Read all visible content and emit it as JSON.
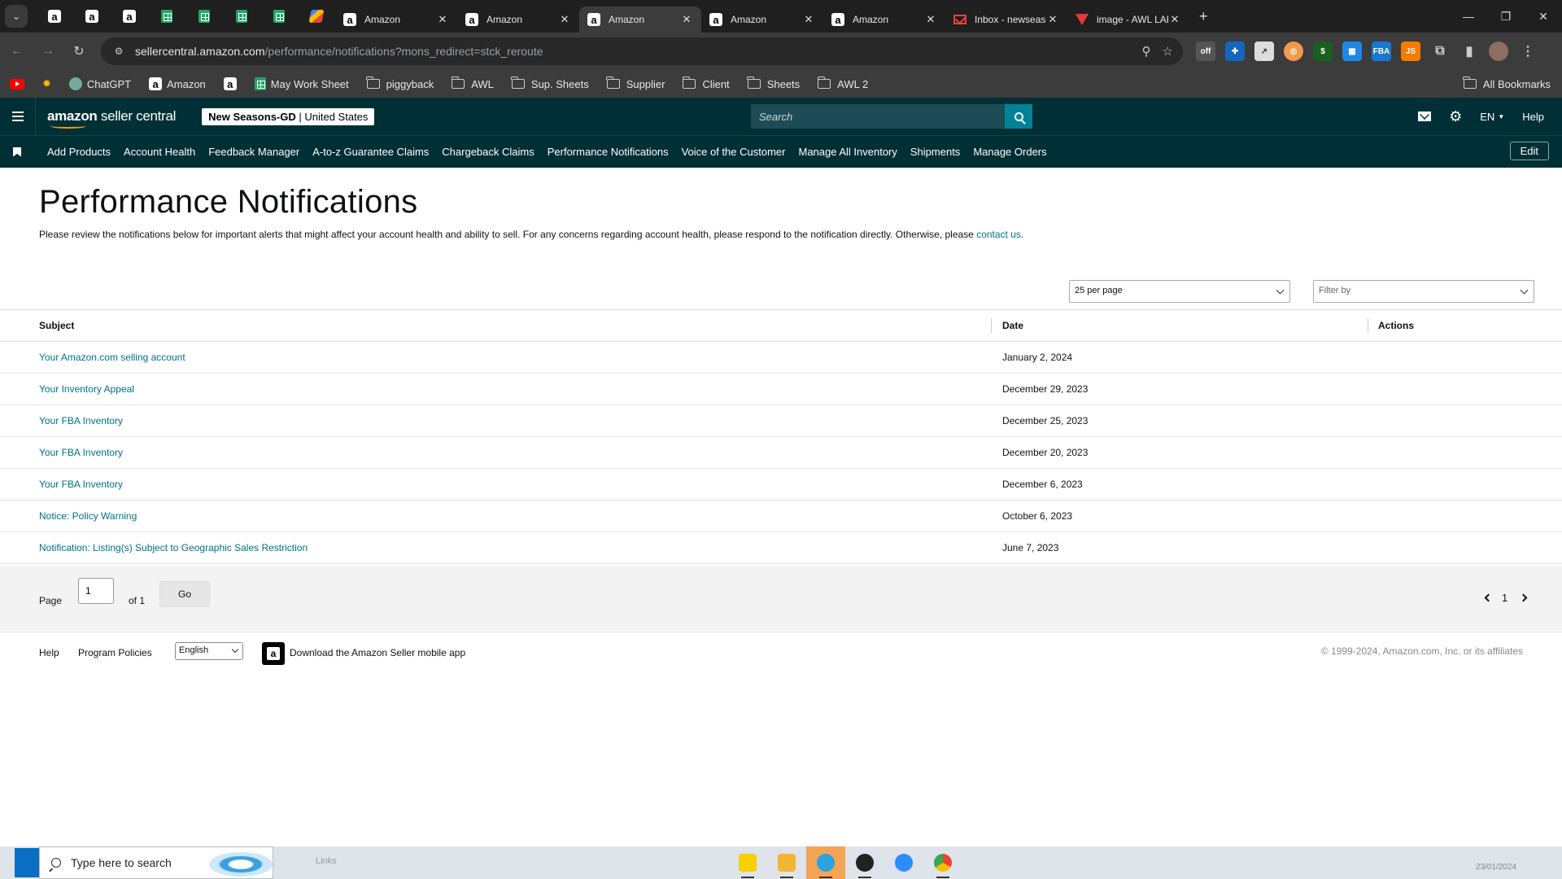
{
  "browser": {
    "tabs": [
      {
        "label": "Amazon",
        "active": false
      },
      {
        "label": "Amazon",
        "active": false
      },
      {
        "label": "Amazon",
        "active": true
      },
      {
        "label": "Amazon",
        "active": false
      },
      {
        "label": "Amazon",
        "active": false
      },
      {
        "label": "Inbox - newseasonsg",
        "active": false
      },
      {
        "label": "image - AWL LABEL",
        "active": false
      }
    ],
    "url_host": "sellercentral.amazon.com",
    "url_path": "/performance/notifications?mons_redirect=stck_reroute",
    "bookmarks": [
      "ChatGPT",
      "Amazon",
      "May Work Sheet",
      "piggyback",
      "AWL",
      "Sup. Sheets",
      "Supplier",
      "Client",
      "Sheets",
      "AWL 2"
    ],
    "all_bookmarks": "All Bookmarks"
  },
  "header": {
    "logo_bold": "amazon",
    "logo_rest": " seller central",
    "account_bold": "New Seasons-GD",
    "account_rest": " | United States",
    "search_placeholder": "Search",
    "language": "EN",
    "help": "Help"
  },
  "nav": {
    "items": [
      "Add Products",
      "Account Health",
      "Feedback Manager",
      "A-to-z Guarantee Claims",
      "Chargeback Claims",
      "Performance Notifications",
      "Voice of the Customer",
      "Manage All Inventory",
      "Shipments",
      "Manage Orders"
    ],
    "edit": "Edit"
  },
  "main": {
    "title": "Performance Notifications",
    "intro": "Please review the notifications below for important alerts that might affect your account health and ability to sell. For any concerns regarding account health, please respond to the notification directly. Otherwise, please ",
    "contact_link": "contact us",
    "intro_end": ".",
    "per_page": "25 per page",
    "filter_placeholder": "Filter by",
    "columns": {
      "subject": "Subject",
      "date": "Date",
      "actions": "Actions"
    },
    "rows": [
      {
        "subject": "Your Amazon.com selling account",
        "date": "January 2, 2024"
      },
      {
        "subject": "Your Inventory Appeal",
        "date": "December 29, 2023"
      },
      {
        "subject": "Your FBA Inventory",
        "date": "December 25, 2023"
      },
      {
        "subject": "Your FBA Inventory",
        "date": "December 20, 2023"
      },
      {
        "subject": "Your FBA Inventory",
        "date": "December 6, 2023"
      },
      {
        "subject": "Notice: Policy Warning",
        "date": "October 6, 2023"
      },
      {
        "subject": "Notification: Listing(s) Subject to Geographic Sales Restriction",
        "date": "June 7, 2023"
      }
    ]
  },
  "pager": {
    "page_label": "Page",
    "page_value": "1",
    "of_label": "of 1",
    "go": "Go",
    "current": "1"
  },
  "footer": {
    "help": "Help",
    "policies": "Program Policies",
    "language": "English",
    "app": "Download the Amazon Seller mobile app",
    "copyright": "© 1999-2024, Amazon.com, Inc. or its affiliates"
  },
  "taskbar": {
    "search_placeholder": "Type here to search",
    "links": "Links",
    "date": "23/01/2024"
  },
  "colors": {
    "header_bg": "#002f36",
    "link": "#007185",
    "search_btn": "#008296"
  }
}
